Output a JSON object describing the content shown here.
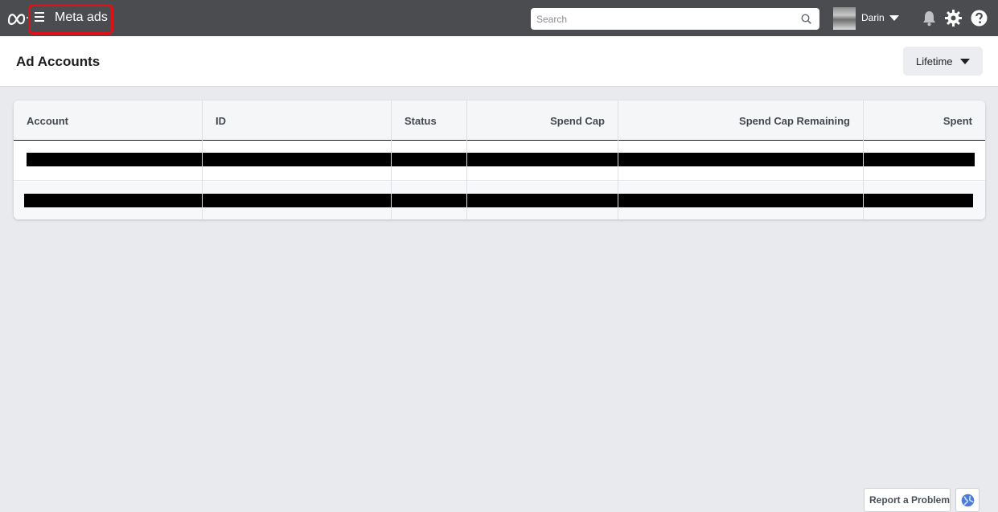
{
  "topbar": {
    "brand_title": "Meta ads",
    "search_placeholder": "Search",
    "user_name": "Darin",
    "icons": [
      "meta-logo-icon",
      "menu-icon",
      "search-icon",
      "chevron-down-icon",
      "bell-icon",
      "gear-icon",
      "help-icon"
    ]
  },
  "header": {
    "page_title": "Ad Accounts",
    "date_range": "Lifetime"
  },
  "table": {
    "columns": [
      "Account",
      "ID",
      "Status",
      "Spend Cap",
      "Spend Cap Remaining",
      "Spent"
    ],
    "rows": [
      {
        "redacted": true
      },
      {
        "redacted": true
      }
    ]
  },
  "footer": {
    "report_label": "Report a Problem",
    "globe_icon": "globe-icon"
  },
  "colors": {
    "topbar_bg": "#4b4c4f",
    "highlight_border": "#e0101a",
    "page_bg": "#e9eaed"
  }
}
